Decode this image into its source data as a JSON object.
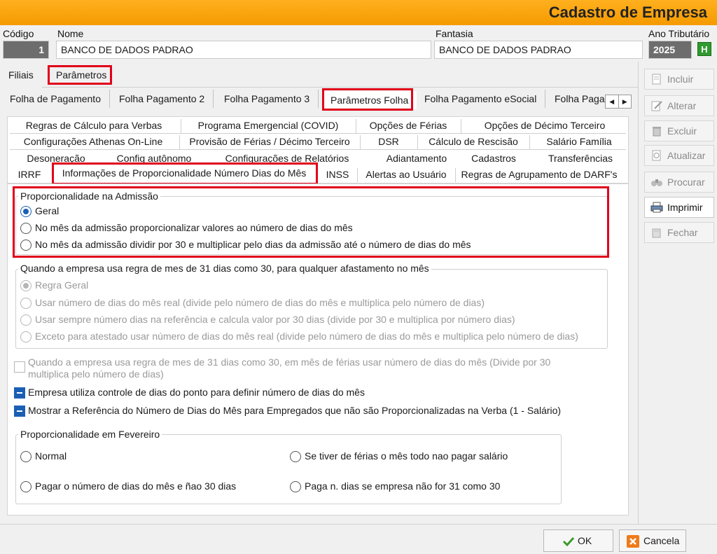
{
  "window": {
    "title": "Cadastro de Empresa"
  },
  "header": {
    "codigo_label": "Código",
    "codigo_value": "1",
    "nome_label": "Nome",
    "nome_value": "BANCO DE DADOS PADRAO",
    "fantasia_label": "Fantasia",
    "fantasia_value": "BANCO DE DADOS PADRAO",
    "ano_label": "Ano Tributário",
    "ano_value": "2025",
    "ano_btn": "H"
  },
  "top_tabs": [
    "Filiais",
    "Parâmetros"
  ],
  "param_tabs": [
    "Folha de Pagamento",
    "Folha Pagamento 2",
    "Folha Pagamento 3",
    "Parâmetros Folha",
    "Folha Pagamento eSocial",
    "Folha Paga"
  ],
  "sub_tabs": {
    "row1": [
      "Regras de Cálculo para Verbas",
      "Programa Emergencial (COVID)",
      "Opções de Férias",
      "Opções de Décimo Terceiro"
    ],
    "row2": [
      "Configurações Athenas On-Line",
      "Provisão de Férias / Décimo Terceiro",
      "DSR",
      "Cálculo de Rescisão",
      "Salário Família"
    ],
    "row3": [
      "Desoneração",
      "Config autônomo",
      "Configurações de Relatórios",
      "Adiantamento",
      "Cadastros",
      "Transferências"
    ],
    "row4": [
      "IRRF",
      "Informações de Proporcionalidade Número Dias do Mês",
      "INSS",
      "Alertas ao Usuário",
      "Regras de Agrupamento de DARF's"
    ]
  },
  "admissao": {
    "legend": "Proporcionalidade na Admissão",
    "options": [
      "Geral",
      "No mês da admissão proporcionalizar valores ao número de dias do mês",
      "No mês da admissão dividir por 30 e multiplicar pelo dias da admissão até o número de dias do mês"
    ]
  },
  "afastamento": {
    "legend": "Quando a empresa usa regra de mes de 31 dias como 30, para qualquer afastamento no mês",
    "options": [
      "Regra Geral",
      "Usar número de dias do mês real (divide pelo número de dias do mês e multiplica pelo número de dias)",
      "Usar sempre número dias na referência e calcula valor por 30 dias (divide por 30 e multiplica por número dias)",
      "Exceto para atestado usar número de dias do mês real (divide pelo número de dias do mês e multiplica pelo número de dias)"
    ]
  },
  "checks": {
    "ferias_line1": "Quando a empresa usa regra de mes de 31 dias como 30, em mês de férias usar número de dias do mês (Divide por 30",
    "ferias_line2": "multiplica pelo número de dias)",
    "ponto": "Empresa utiliza controle de dias do ponto para definir número de dias do mês",
    "referencia": "Mostrar a Referência do Número de Dias do Mês para  Empregados que não são Proporcionalizadas na Verba (1 - Salário)"
  },
  "fevereiro": {
    "legend": "Proporcionalidade em Fevereiro",
    "normal": "Normal",
    "ferias": "Se tiver de férias o mês todo nao pagar salário",
    "pagar": "Pagar o número de dias do mês e ñao 30 dias",
    "paga_n": "Paga n. dias se empresa não for 31 como 30"
  },
  "side_buttons": [
    "Incluir",
    "Alterar",
    "Excluir",
    "Atualizar",
    "Procurar",
    "Imprimir",
    "Fechar"
  ],
  "footer": {
    "ok": "OK",
    "cancel": "Cancela"
  },
  "colors": {
    "accent": "#f59a00",
    "highlight": "#e0001a",
    "selected": "#1a5fb4"
  }
}
